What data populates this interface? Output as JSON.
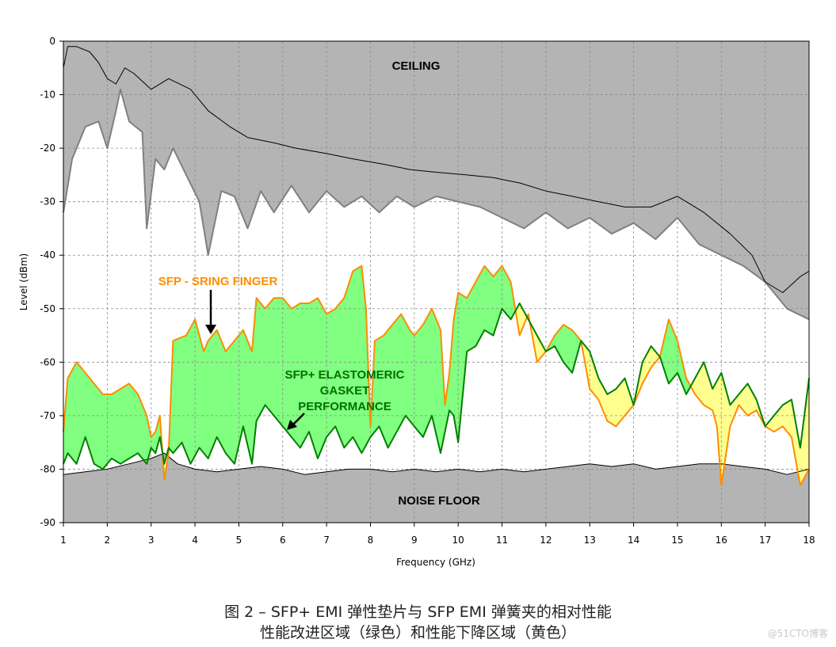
{
  "chart_data": {
    "type": "line",
    "xlabel": "Frequency (GHz)",
    "ylabel": "Level (dBm)",
    "xlim": [
      1,
      18
    ],
    "ylim": [
      -90,
      0
    ],
    "x_ticks": [
      1,
      2,
      3,
      4,
      5,
      6,
      7,
      8,
      9,
      10,
      11,
      12,
      13,
      14,
      15,
      16,
      17,
      18
    ],
    "y_ticks": [
      0,
      -10,
      -20,
      -30,
      -40,
      -50,
      -60,
      -70,
      -80,
      -90
    ],
    "grid": true,
    "colors": {
      "ceiling_fill": "#b4b4b4",
      "noise_fill": "#b4b4b4",
      "improvement_fill": "#80ff80",
      "degradation_fill": "#ffff90",
      "spring_finger": "#ff8c00",
      "gasket": "#008000",
      "ceiling_lower": "#808080",
      "ceiling_upper": "#000000",
      "noise_line": "#000000"
    },
    "series": [
      {
        "key": "ceiling_upper",
        "x": [
          1,
          1.1,
          1.3,
          1.6,
          1.8,
          2.0,
          2.2,
          2.4,
          2.6,
          3.0,
          3.4,
          3.9,
          4.3,
          4.8,
          5.2,
          5.8,
          6.3,
          7.0,
          7.6,
          8.3,
          8.9,
          9.5,
          10.2,
          10.8,
          11.4,
          12.0,
          12.6,
          13.2,
          13.8,
          14.4,
          15.0,
          15.6,
          16.2,
          16.7,
          17.0,
          17.4,
          17.8,
          18
        ],
        "values": [
          -5,
          -1,
          -1,
          -2,
          -4,
          -7,
          -8,
          -5,
          -6,
          -9,
          -7,
          -9,
          -13,
          -16,
          -18,
          -19,
          -20,
          -21,
          -22,
          -23,
          -24,
          -24.5,
          -25,
          -25.5,
          -26.5,
          -28,
          -29,
          -30,
          -31,
          -31,
          -29,
          -32,
          -36,
          -40,
          -45,
          -47,
          -44,
          -43
        ]
      },
      {
        "key": "ceiling_lower",
        "x": [
          1,
          1.2,
          1.5,
          1.8,
          2.0,
          2.2,
          2.3,
          2.5,
          2.8,
          2.9,
          3.1,
          3.3,
          3.5,
          3.8,
          4.1,
          4.3,
          4.6,
          4.9,
          5.2,
          5.5,
          5.8,
          6.2,
          6.6,
          7.0,
          7.4,
          7.8,
          8.2,
          8.6,
          9.0,
          9.5,
          10.0,
          10.5,
          11.0,
          11.5,
          12.0,
          12.5,
          13.0,
          13.5,
          14.0,
          14.5,
          15.0,
          15.5,
          16.0,
          16.5,
          17.0,
          17.5,
          18
        ],
        "values": [
          -32,
          -22,
          -16,
          -15,
          -20,
          -13,
          -9,
          -15,
          -17,
          -35,
          -22,
          -24,
          -20,
          -25,
          -30,
          -40,
          -28,
          -29,
          -35,
          -28,
          -32,
          -27,
          -32,
          -28,
          -31,
          -29,
          -32,
          -29,
          -31,
          -29,
          -30,
          -31,
          -33,
          -35,
          -32,
          -35,
          -33,
          -36,
          -34,
          -37,
          -33,
          -38,
          -40,
          -42,
          -45,
          -50,
          -52
        ]
      },
      {
        "key": "spring_finger",
        "x": [
          1,
          1.1,
          1.3,
          1.5,
          1.7,
          1.9,
          2.1,
          2.3,
          2.5,
          2.7,
          2.9,
          3.0,
          3.1,
          3.2,
          3.3,
          3.4,
          3.5,
          3.8,
          4.0,
          4.2,
          4.3,
          4.5,
          4.7,
          4.9,
          5.1,
          5.3,
          5.4,
          5.6,
          5.8,
          6.0,
          6.2,
          6.4,
          6.6,
          6.8,
          7.0,
          7.2,
          7.4,
          7.6,
          7.8,
          7.9,
          8.0,
          8.1,
          8.3,
          8.5,
          8.7,
          8.9,
          9.0,
          9.2,
          9.4,
          9.6,
          9.7,
          9.8,
          9.9,
          10.0,
          10.2,
          10.4,
          10.6,
          10.8,
          11.0,
          11.2,
          11.4,
          11.6,
          11.8,
          12.0,
          12.2,
          12.4,
          12.6,
          12.8,
          13.0,
          13.2,
          13.4,
          13.6,
          13.8,
          14.0,
          14.2,
          14.4,
          14.6,
          14.8,
          15.0,
          15.2,
          15.4,
          15.6,
          15.8,
          15.9,
          16.0,
          16.2,
          16.4,
          16.6,
          16.8,
          17.0,
          17.2,
          17.4,
          17.6,
          17.8,
          18
        ],
        "values": [
          -73,
          -63,
          -60,
          -62,
          -64,
          -66,
          -66,
          -65,
          -64,
          -66,
          -70,
          -74,
          -73,
          -70,
          -82,
          -77,
          -56,
          -55,
          -52,
          -58,
          -56,
          -54,
          -58,
          -56,
          -54,
          -58,
          -48,
          -50,
          -48,
          -48,
          -50,
          -49,
          -49,
          -48,
          -51,
          -50,
          -48,
          -43,
          -42,
          -50,
          -72,
          -56,
          -55,
          -53,
          -51,
          -54,
          -55,
          -53,
          -50,
          -54,
          -68,
          -62,
          -52,
          -47,
          -48,
          -45,
          -42,
          -44,
          -42,
          -45,
          -55,
          -51,
          -60,
          -58,
          -55,
          -53,
          -54,
          -56,
          -65,
          -67,
          -71,
          -72,
          -70,
          -68,
          -64,
          -61,
          -59,
          -52,
          -56,
          -63,
          -66,
          -68,
          -69,
          -72,
          -83,
          -72,
          -68,
          -70,
          -69,
          -72,
          -73,
          -72,
          -74,
          -83,
          -80
        ]
      },
      {
        "key": "gasket",
        "x": [
          1,
          1.1,
          1.3,
          1.5,
          1.7,
          1.9,
          2.1,
          2.3,
          2.5,
          2.7,
          2.9,
          3.0,
          3.1,
          3.2,
          3.3,
          3.4,
          3.5,
          3.7,
          3.9,
          4.1,
          4.3,
          4.5,
          4.7,
          4.9,
          5.1,
          5.3,
          5.4,
          5.6,
          5.8,
          6.0,
          6.2,
          6.4,
          6.6,
          6.8,
          7.0,
          7.2,
          7.4,
          7.6,
          7.8,
          8.0,
          8.2,
          8.4,
          8.6,
          8.8,
          9.0,
          9.2,
          9.4,
          9.6,
          9.8,
          9.9,
          10.0,
          10.2,
          10.4,
          10.6,
          10.8,
          11.0,
          11.2,
          11.4,
          11.6,
          11.8,
          12.0,
          12.2,
          12.4,
          12.6,
          12.8,
          13.0,
          13.2,
          13.4,
          13.6,
          13.8,
          14.0,
          14.2,
          14.4,
          14.6,
          14.8,
          15.0,
          15.2,
          15.4,
          15.6,
          15.8,
          16.0,
          16.2,
          16.4,
          16.6,
          16.8,
          17.0,
          17.2,
          17.4,
          17.6,
          17.8,
          18
        ],
        "values": [
          -79,
          -77,
          -79,
          -74,
          -79,
          -80,
          -78,
          -79,
          -78,
          -77,
          -79,
          -76,
          -77,
          -74,
          -79,
          -76,
          -77,
          -75,
          -79,
          -76,
          -78,
          -74,
          -77,
          -79,
          -72,
          -79,
          -71,
          -68,
          -70,
          -72,
          -74,
          -76,
          -73,
          -78,
          -74,
          -72,
          -76,
          -74,
          -77,
          -74,
          -72,
          -76,
          -73,
          -70,
          -72,
          -74,
          -70,
          -77,
          -69,
          -70,
          -75,
          -58,
          -57,
          -54,
          -55,
          -50,
          -52,
          -49,
          -52,
          -55,
          -58,
          -57,
          -60,
          -62,
          -56,
          -58,
          -63,
          -66,
          -65,
          -63,
          -68,
          -60,
          -57,
          -59,
          -64,
          -62,
          -66,
          -63,
          -60,
          -65,
          -62,
          -68,
          -66,
          -64,
          -67,
          -72,
          -70,
          -68,
          -67,
          -76,
          -63
        ]
      },
      {
        "key": "noise_floor",
        "x": [
          1,
          1.5,
          2.0,
          2.5,
          3.0,
          3.3,
          3.6,
          4.0,
          4.5,
          5.0,
          5.5,
          6.0,
          6.5,
          7.0,
          7.5,
          8.0,
          8.5,
          9.0,
          9.5,
          10.0,
          10.5,
          11.0,
          11.5,
          12.0,
          12.5,
          13.0,
          13.5,
          14.0,
          14.5,
          15.0,
          15.5,
          16.0,
          16.5,
          17.0,
          17.5,
          18
        ],
        "values": [
          -81,
          -80.5,
          -80,
          -79,
          -78,
          -77,
          -79,
          -80,
          -80.5,
          -80,
          -79.5,
          -80,
          -81,
          -80.5,
          -80,
          -80,
          -80.5,
          -80,
          -80.5,
          -80,
          -80.5,
          -80,
          -80.5,
          -80,
          -79.5,
          -79,
          -79.5,
          -79,
          -80,
          -79.5,
          -79,
          -79,
          -79.5,
          -80,
          -81,
          -80
        ]
      }
    ],
    "annotations": [
      {
        "key": "ceiling",
        "text": "CEILING"
      },
      {
        "key": "noise",
        "text": "NOISE FLOOR"
      },
      {
        "key": "spring",
        "text": "SFP - SRING FINGER"
      },
      {
        "key": "gasket",
        "lines": [
          "SFP+ ELASTOMERIC",
          "GASKET",
          "PERFORMANCE"
        ]
      }
    ]
  },
  "caption": {
    "line1": "图 2 – SFP+ EMI 弹性垫片与 SFP EMI 弹簧夹的相对性能",
    "line2": "性能改进区域（绿色）和性能下降区域（黄色）"
  },
  "watermark": "@51CTO博客"
}
